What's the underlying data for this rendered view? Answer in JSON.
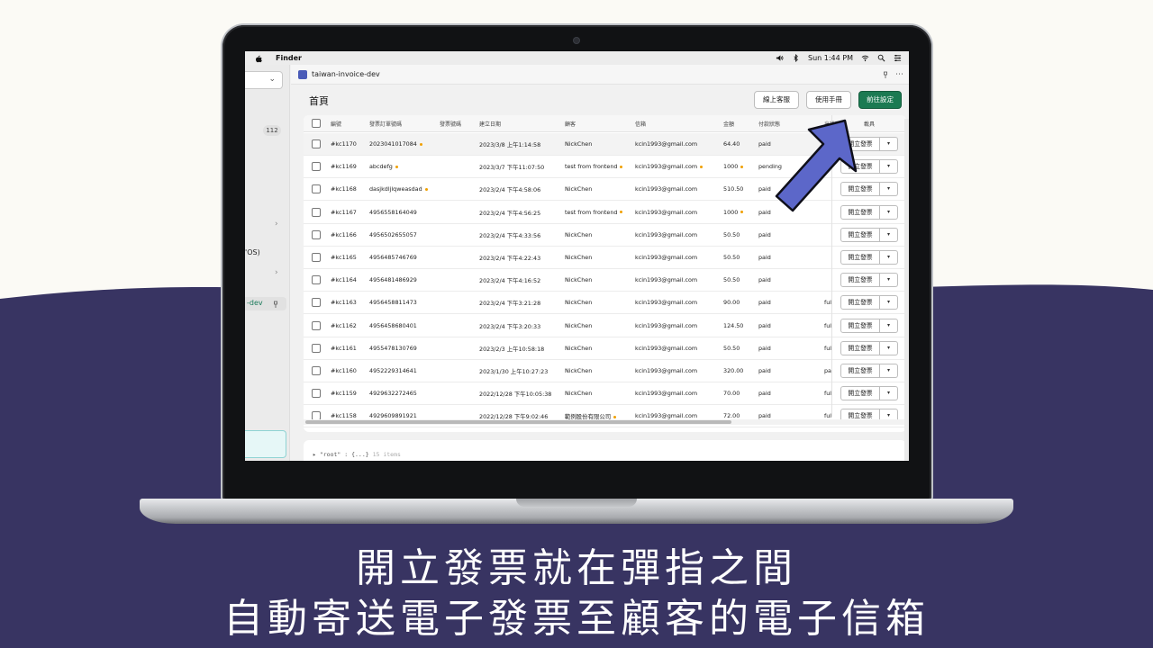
{
  "colors": {
    "background_light": "#fbfaf5",
    "background_dark": "#383462",
    "arrow": "#5c67c9",
    "primary_button": "#1b7a52"
  },
  "menubar": {
    "app_name": "Finder",
    "clock": "Sun 1:44 PM"
  },
  "sidebar": {
    "badge": "112",
    "partial_text_1": "'OS)",
    "active_item": "-dev"
  },
  "app_header": {
    "title": "taiwan-invoice-dev",
    "more_icon": "⋯"
  },
  "page": {
    "title": "首頁",
    "buttons": {
      "support": "線上客服",
      "manual": "使用手冊",
      "settings": "前往設定"
    }
  },
  "table": {
    "columns": [
      "編號",
      "發票訂單號碼",
      "發票號碼",
      "建立日期",
      "顧客",
      "信箱",
      "金額",
      "付款狀態",
      "出貨狀態",
      "載具"
    ],
    "action_label": "開立發票",
    "rows": [
      {
        "id": "#kc1170",
        "order": "2023041017084",
        "order_flag": true,
        "date": "2023/3/8 上午1:14:58",
        "customer": "NickChen",
        "customer_flag": false,
        "email": "kcin1993@gmail.com",
        "email_flag": false,
        "amount": "64.40",
        "amount_flag": false,
        "payment": "paid",
        "fulfillment": ""
      },
      {
        "id": "#kc1169",
        "order": "abcdefg",
        "order_flag": true,
        "date": "2023/3/7 下午11:07:50",
        "customer": "test from frontend",
        "customer_flag": true,
        "email": "kcin1993@gmail.com",
        "email_flag": true,
        "amount": "1000",
        "amount_flag": true,
        "payment": "pending",
        "fulfillment": ""
      },
      {
        "id": "#kc1168",
        "order": "dasjkdljlqweasdad",
        "order_flag": true,
        "date": "2023/2/4 下午4:58:06",
        "customer": "NickChen",
        "customer_flag": false,
        "email": "kcin1993@gmail.com",
        "email_flag": false,
        "amount": "510.50",
        "amount_flag": false,
        "payment": "paid",
        "fulfillment": ""
      },
      {
        "id": "#kc1167",
        "order": "4956558164049",
        "order_flag": false,
        "date": "2023/2/4 下午4:56:25",
        "customer": "test from frontend",
        "customer_flag": true,
        "email": "kcin1993@gmail.com",
        "email_flag": false,
        "amount": "1000",
        "amount_flag": true,
        "payment": "paid",
        "fulfillment": ""
      },
      {
        "id": "#kc1166",
        "order": "4956502655057",
        "order_flag": false,
        "date": "2023/2/4 下午4:33:56",
        "customer": "NickChen",
        "customer_flag": false,
        "email": "kcin1993@gmail.com",
        "email_flag": false,
        "amount": "50.50",
        "amount_flag": false,
        "payment": "paid",
        "fulfillment": ""
      },
      {
        "id": "#kc1165",
        "order": "4956485746769",
        "order_flag": false,
        "date": "2023/2/4 下午4:22:43",
        "customer": "NickChen",
        "customer_flag": false,
        "email": "kcin1993@gmail.com",
        "email_flag": false,
        "amount": "50.50",
        "amount_flag": false,
        "payment": "paid",
        "fulfillment": ""
      },
      {
        "id": "#kc1164",
        "order": "4956481486929",
        "order_flag": false,
        "date": "2023/2/4 下午4:16:52",
        "customer": "NickChen",
        "customer_flag": false,
        "email": "kcin1993@gmail.com",
        "email_flag": false,
        "amount": "50.50",
        "amount_flag": false,
        "payment": "paid",
        "fulfillment": ""
      },
      {
        "id": "#kc1163",
        "order": "4956458811473",
        "order_flag": false,
        "date": "2023/2/4 下午3:21:28",
        "customer": "NickChen",
        "customer_flag": false,
        "email": "kcin1993@gmail.com",
        "email_flag": false,
        "amount": "90.00",
        "amount_flag": false,
        "payment": "paid",
        "fulfillment": "ful"
      },
      {
        "id": "#kc1162",
        "order": "4956458680401",
        "order_flag": false,
        "date": "2023/2/4 下午3:20:33",
        "customer": "NickChen",
        "customer_flag": false,
        "email": "kcin1993@gmail.com",
        "email_flag": false,
        "amount": "124.50",
        "amount_flag": false,
        "payment": "paid",
        "fulfillment": "ful"
      },
      {
        "id": "#kc1161",
        "order": "4955478130769",
        "order_flag": false,
        "date": "2023/2/3 上午10:58:18",
        "customer": "NickChen",
        "customer_flag": false,
        "email": "kcin1993@gmail.com",
        "email_flag": false,
        "amount": "50.50",
        "amount_flag": false,
        "payment": "paid",
        "fulfillment": "ful"
      },
      {
        "id": "#kc1160",
        "order": "4952229314641",
        "order_flag": false,
        "date": "2023/1/30 上午10:27:23",
        "customer": "NickChen",
        "customer_flag": false,
        "email": "kcin1993@gmail.com",
        "email_flag": false,
        "amount": "320.00",
        "amount_flag": false,
        "payment": "paid",
        "fulfillment": "pa"
      },
      {
        "id": "#kc1159",
        "order": "4929632272465",
        "order_flag": false,
        "date": "2022/12/28 下午10:05:38",
        "customer": "NickChen",
        "customer_flag": false,
        "email": "kcin1993@gmail.com",
        "email_flag": false,
        "amount": "70.00",
        "amount_flag": false,
        "payment": "paid",
        "fulfillment": "ful"
      },
      {
        "id": "#kc1158",
        "order": "4929609891921",
        "order_flag": false,
        "date": "2022/12/28 下午9:02:46",
        "customer": "範例股份有限公司",
        "customer_flag": true,
        "email": "kcin1993@gmail.com",
        "email_flag": false,
        "amount": "72.00",
        "amount_flag": false,
        "payment": "paid",
        "fulfillment": "ful"
      }
    ]
  },
  "json_viewer": {
    "key": "\"root\"",
    "value": "{...}",
    "meta": "15 items"
  },
  "captions": {
    "line1": "開立發票就在彈指之間",
    "line2": "自動寄送電子發票至顧客的電子信箱"
  }
}
